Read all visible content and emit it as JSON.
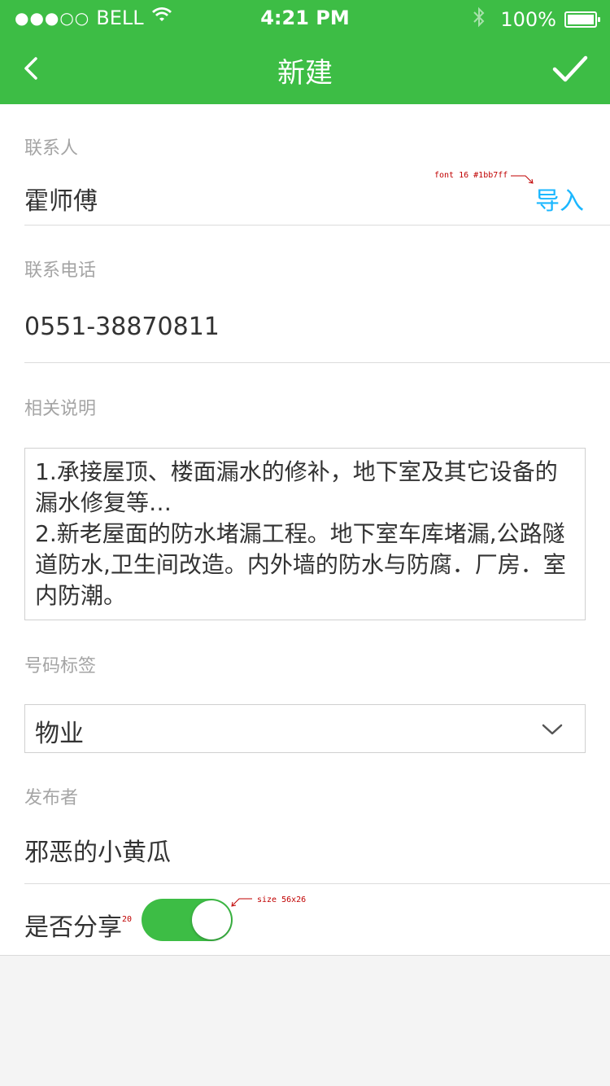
{
  "status_bar": {
    "signal_dots": "●●●○○",
    "carrier": "BELL",
    "time": "4:21 PM",
    "battery_percent": "100%",
    "icons": [
      "wifi-icon",
      "bluetooth-icon",
      "battery-icon"
    ]
  },
  "nav": {
    "title": "新建",
    "icons": [
      "back-chevron-icon",
      "checkmark-icon"
    ]
  },
  "form": {
    "contact": {
      "label": "联系人",
      "value": "霍师傅",
      "import_label": "导入"
    },
    "phone": {
      "label": "联系电话",
      "value": "0551-38870811"
    },
    "description": {
      "label": "相关说明",
      "line1": "1.承接屋顶、楼面漏水的修补，地下室及其它设备的漏水修复等…",
      "line2": "2.新老屋面的防水堵漏工程。地下室车库堵漏,公路隧道防水,卫生间改造。内外墙的防水与防腐．厂房．室内防潮。"
    },
    "tag": {
      "label": "号码标签",
      "selected": "物业"
    },
    "publisher": {
      "label": "发布者",
      "value": "邪恶的小黄瓜"
    },
    "share": {
      "label": "是否分享",
      "enabled": true
    }
  },
  "annotations": {
    "import_note": "font 16 #1bb7ff",
    "toggle_size_note": "size 56x26",
    "gap_note": "20"
  },
  "colors": {
    "brand_green": "#3dbd45",
    "link_blue": "#1bb7ff",
    "label_gray": "#a5a5a5"
  }
}
